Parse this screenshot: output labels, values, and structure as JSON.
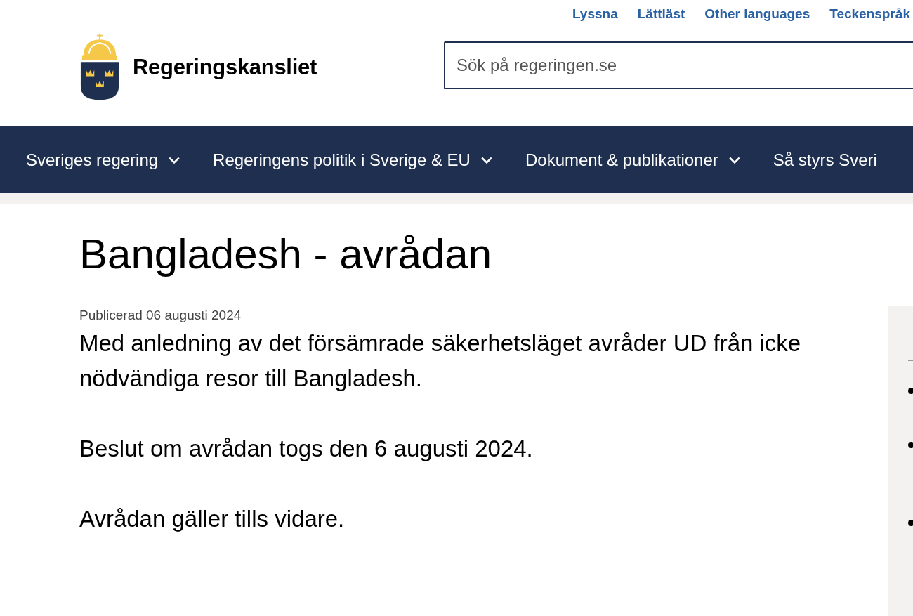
{
  "top_links": [
    {
      "label": "Lyssna"
    },
    {
      "label": "Lättläst"
    },
    {
      "label": "Other languages"
    },
    {
      "label": "Teckenspråk"
    }
  ],
  "logo": {
    "text": "Regeringskansliet"
  },
  "search": {
    "placeholder": "Sök på regeringen.se"
  },
  "nav": [
    {
      "label": "Sveriges regering",
      "has_menu": true
    },
    {
      "label": "Regeringens politik i Sverige & EU",
      "has_menu": true
    },
    {
      "label": "Dokument & publikationer",
      "has_menu": true
    },
    {
      "label": "Så styrs Sveri",
      "has_menu": false
    }
  ],
  "article": {
    "title": "Bangladesh - avrådan",
    "published": "Publicerad 06 augusti 2024",
    "paragraphs": [
      "Med anledning av det försämrade säkerhetsläget avråder UD från icke nödvändiga resor till Bangladesh.",
      "Beslut om avrådan togs den 6 augusti 2024.",
      "Avrådan gäller tills vidare."
    ]
  },
  "side_panel": {
    "items": [
      {
        "kind": "bullet"
      },
      {
        "kind": "bullet"
      },
      {
        "kind": "bullet"
      }
    ]
  }
}
